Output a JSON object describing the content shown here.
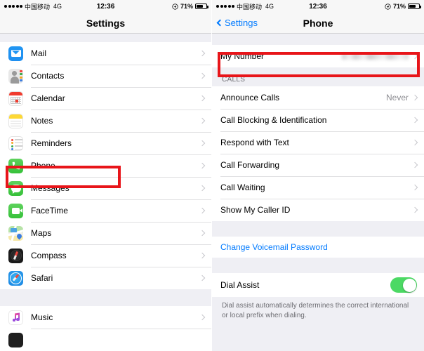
{
  "status_bar": {
    "signal_dots": 5,
    "carrier": "中国移动",
    "network": "4G",
    "time": "12:36",
    "battery_percent": "71%",
    "battery_level": 71,
    "location_icon": "location-arrow-icon"
  },
  "left_screen": {
    "nav_title": "Settings",
    "groups": [
      {
        "items": [
          {
            "label": "Mail",
            "icon": "mail-icon",
            "accessory": "chevron-right-icon"
          },
          {
            "label": "Contacts",
            "icon": "contacts-icon",
            "accessory": "chevron-right-icon"
          },
          {
            "label": "Calendar",
            "icon": "calendar-icon",
            "accessory": "chevron-right-icon"
          },
          {
            "label": "Notes",
            "icon": "notes-icon",
            "accessory": "chevron-right-icon"
          },
          {
            "label": "Reminders",
            "icon": "reminders-icon",
            "accessory": "chevron-right-icon"
          },
          {
            "label": "Phone",
            "icon": "phone-icon",
            "accessory": "chevron-right-icon",
            "highlighted": true
          },
          {
            "label": "Messages",
            "icon": "messages-icon",
            "accessory": "chevron-right-icon"
          },
          {
            "label": "FaceTime",
            "icon": "facetime-icon",
            "accessory": "chevron-right-icon"
          },
          {
            "label": "Maps",
            "icon": "maps-icon",
            "accessory": "chevron-right-icon"
          },
          {
            "label": "Compass",
            "icon": "compass-icon",
            "accessory": "chevron-right-icon"
          },
          {
            "label": "Safari",
            "icon": "safari-icon",
            "accessory": "chevron-right-icon"
          }
        ]
      },
      {
        "items": [
          {
            "label": "Music",
            "icon": "music-icon",
            "accessory": "chevron-right-icon"
          }
        ]
      }
    ]
  },
  "right_screen": {
    "back_label": "Settings",
    "nav_title": "Phone",
    "my_number": {
      "label": "My Number",
      "value": "",
      "value_redacted": true,
      "highlighted": true
    },
    "calls_section": {
      "header": "CALLS",
      "items": [
        {
          "label": "Announce Calls",
          "value": "Never"
        },
        {
          "label": "Call Blocking & Identification",
          "value": ""
        },
        {
          "label": "Respond with Text",
          "value": ""
        },
        {
          "label": "Call Forwarding",
          "value": ""
        },
        {
          "label": "Call Waiting",
          "value": ""
        },
        {
          "label": "Show My Caller ID",
          "value": ""
        }
      ]
    },
    "voicemail": {
      "label": "Change Voicemail Password"
    },
    "dial_assist": {
      "label": "Dial Assist",
      "enabled": true,
      "note": "Dial assist automatically determines the correct international or local prefix when dialing."
    }
  },
  "colors": {
    "annotation": "#e8151a",
    "accent_blue": "#007aff",
    "toggle_on": "#4cd964",
    "group_bg": "#efeff4"
  }
}
